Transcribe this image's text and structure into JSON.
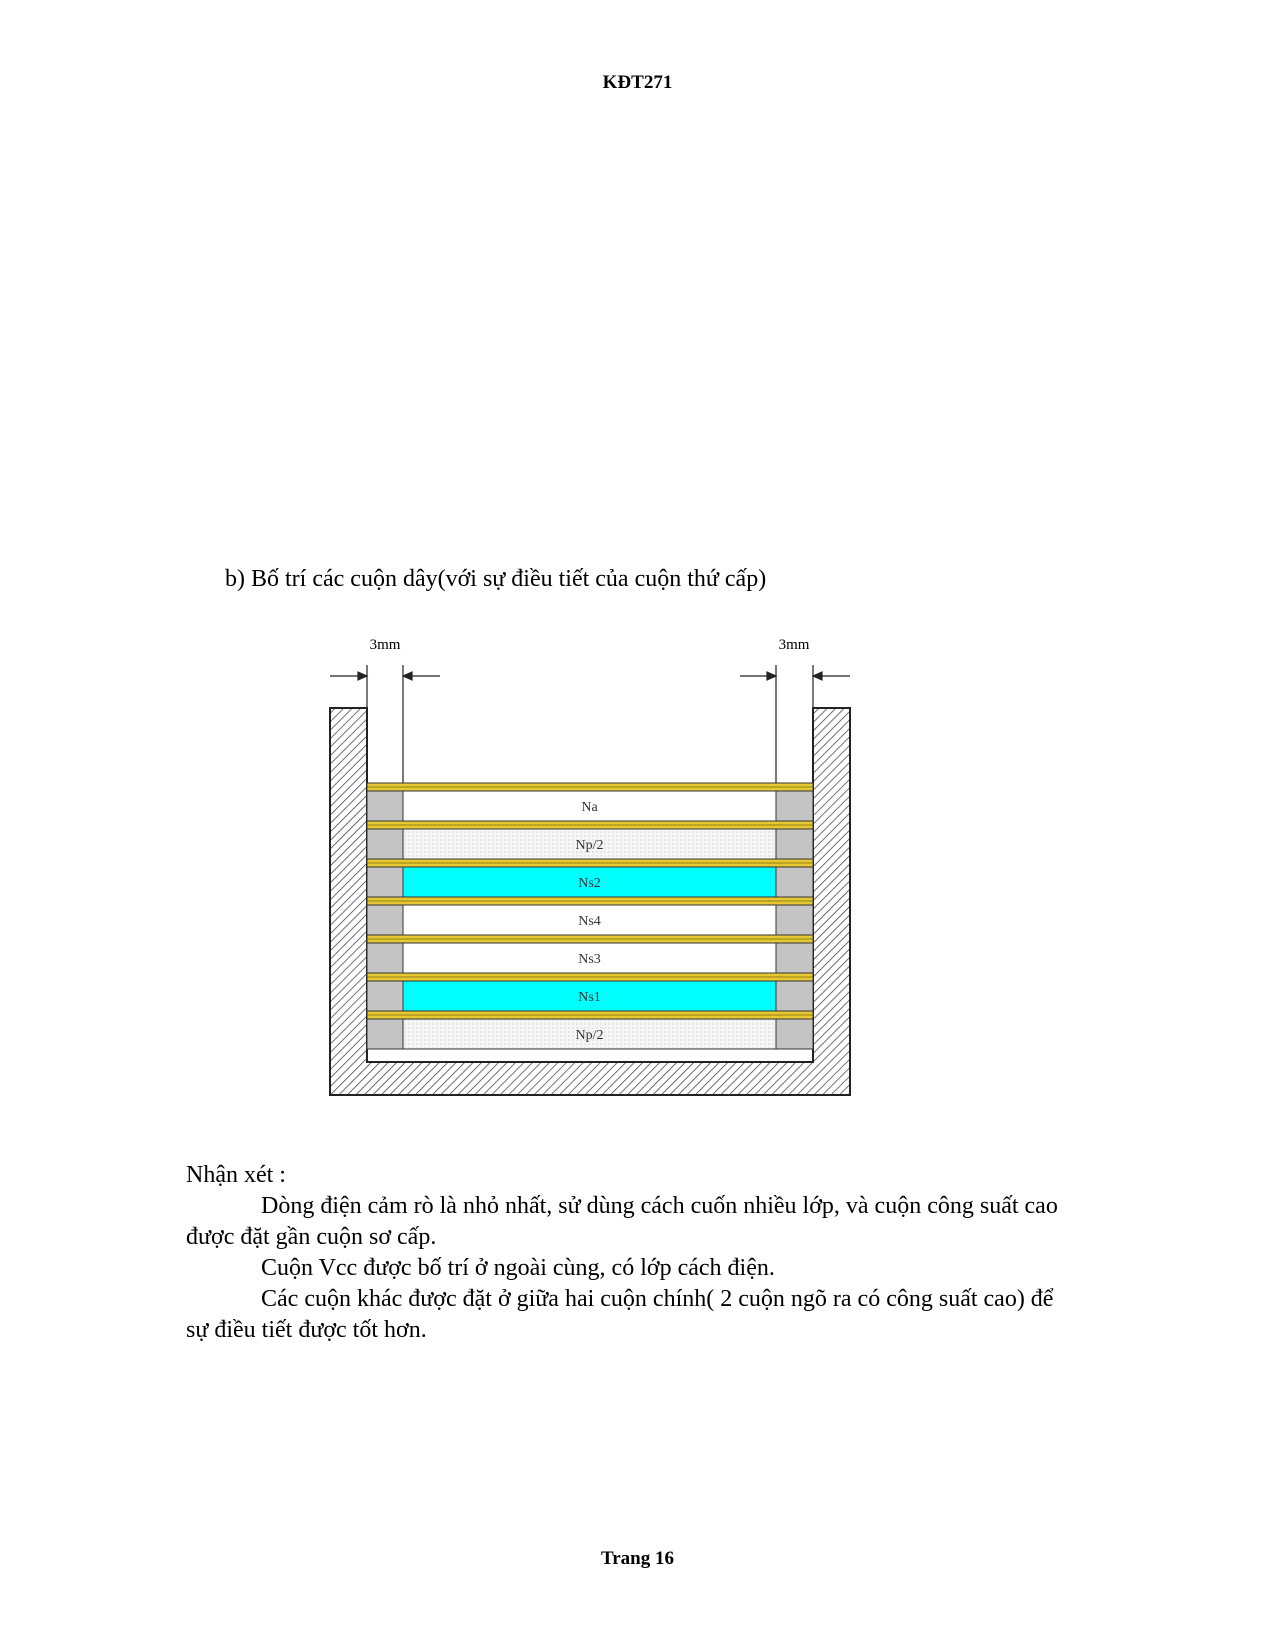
{
  "header": {
    "code": "KĐT271"
  },
  "section": {
    "heading": "b) Bố trí các cuộn dây(với sự điều tiết của cuộn thứ cấp)"
  },
  "figure": {
    "dim_left": "3mm",
    "dim_right": "3mm",
    "layers": [
      "Na",
      "Np/2",
      "Ns2",
      "Ns4",
      "Ns3",
      "Ns1",
      "Np/2"
    ],
    "colors": {
      "secondary_fill": "#00ffff",
      "insulation": "#e6c832",
      "spacer": "#c4c4c4"
    }
  },
  "remarks": {
    "title": "Nhận xét :",
    "paragraphs": [
      "Dòng điện cảm rò là nhỏ nhất, sử dùng cách cuốn nhiều lớp, và cuộn công suất cao được đặt gần cuộn sơ cấp.",
      "Cuộn Vcc được bố trí ở ngoài cùng, có lớp cách điện.",
      "Các cuộn khác được đặt ở giữa hai cuộn chính( 2 cuộn ngõ ra có công suất cao) để sự điều tiết được tốt hơn."
    ]
  },
  "footer": {
    "page": "Trang 16"
  }
}
